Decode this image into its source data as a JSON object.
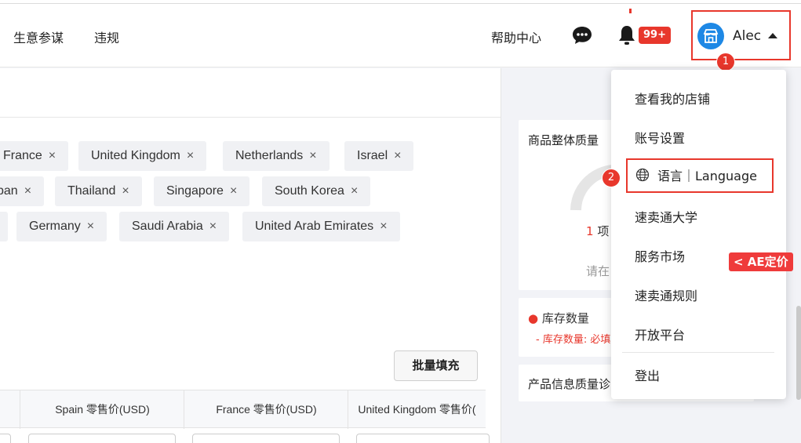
{
  "topbar": {
    "nav": [
      "生意参谋",
      "违规"
    ],
    "help": "帮助中心",
    "notification_count": "99+",
    "user_name": "Alec",
    "step1": "1"
  },
  "tags": {
    "row1": [
      "France",
      "United Kingdom",
      "Netherlands",
      "Israel"
    ],
    "row2": [
      "pan",
      "Thailand",
      "Singapore",
      "South Korea"
    ],
    "row3": [
      "Germany",
      "Saudi Arabia",
      "United Arab Emirates"
    ],
    "remove_glyph": "×"
  },
  "actions": {
    "batch_fill": "批量填充"
  },
  "table": {
    "headers": [
      "Spain 零售价(USD)",
      "France 零售价(USD)",
      "United Kingdom 零售价("
    ]
  },
  "side": {
    "quality_title": "商品整体质量",
    "quality_count": "1",
    "quality_unit": "项",
    "quality_hint": "请在",
    "stock_title": "库存数量",
    "stock_note": "- 库存数量: 必填",
    "info_title": "产品信息质量诊"
  },
  "dropdown": {
    "items": [
      "查看我的店铺",
      "账号设置",
      "语言｜Language",
      "速卖通大学",
      "服务市场",
      "速卖通规则",
      "开放平台"
    ],
    "logout": "登出",
    "step2": "2"
  },
  "ae_badge": "< AE定价",
  "colors": {
    "accent_red": "#e8372c",
    "avatar_blue": "#1e88e5"
  }
}
